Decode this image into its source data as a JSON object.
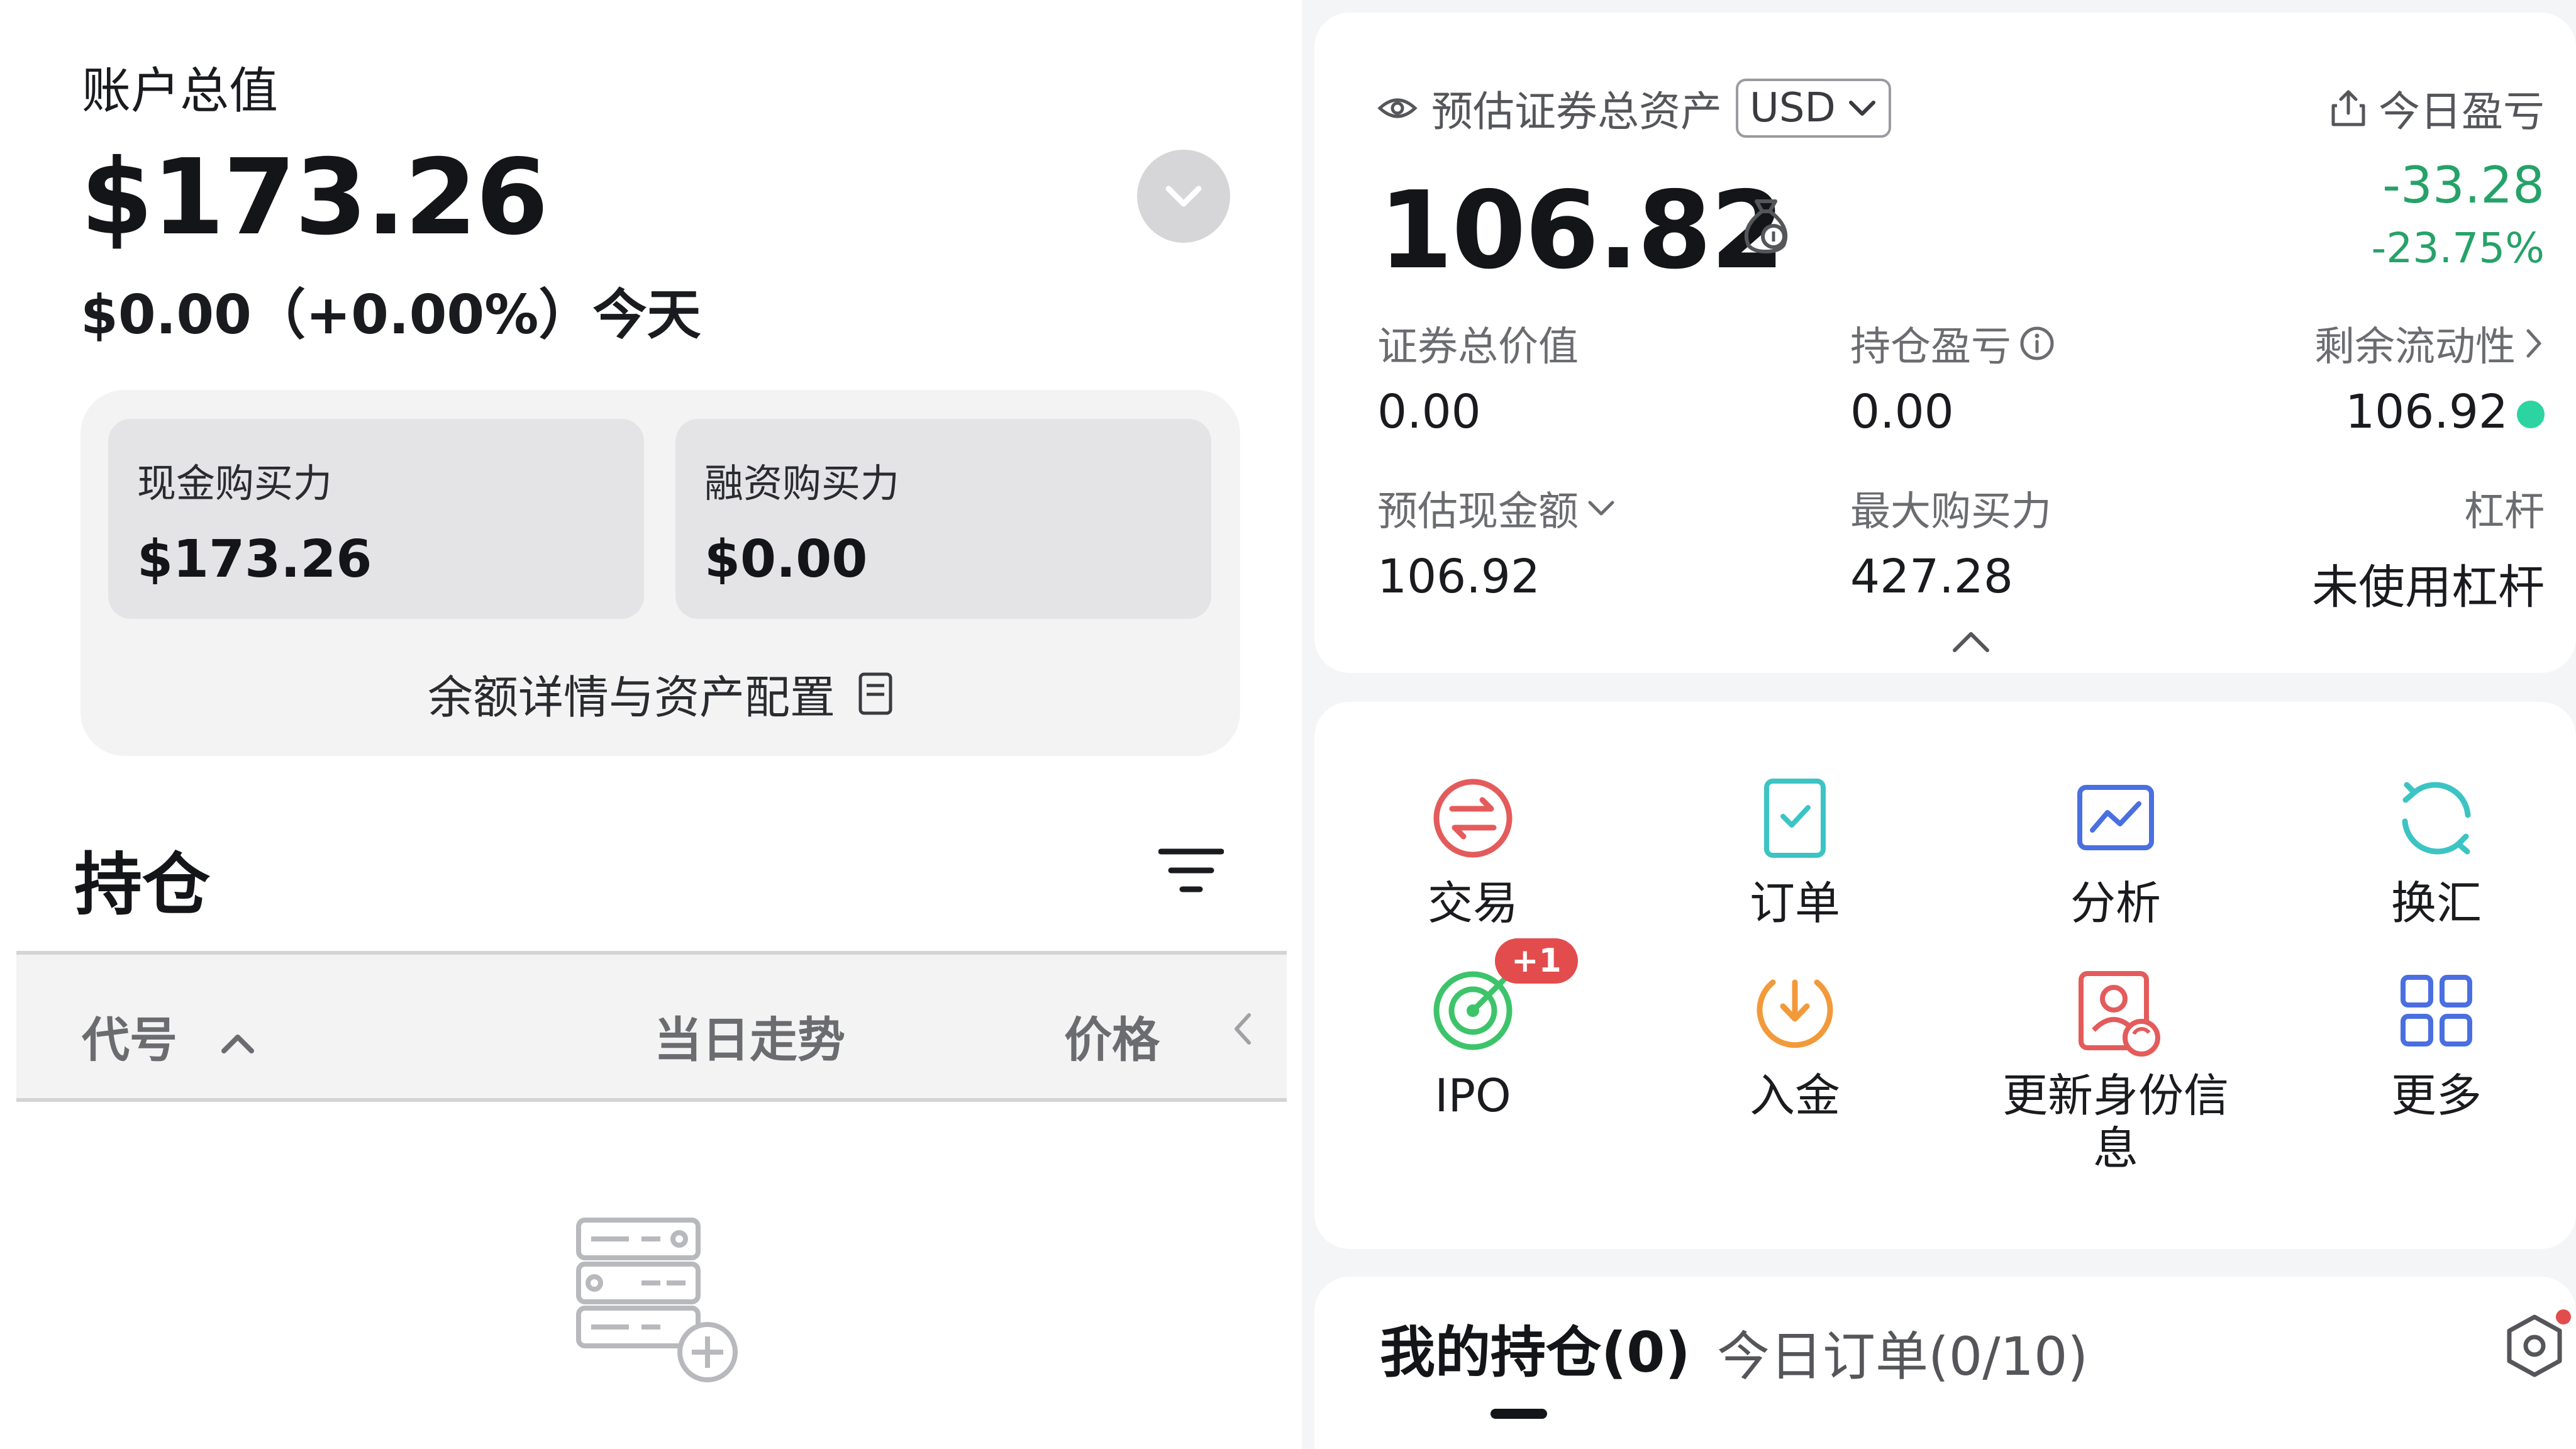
{
  "left": {
    "account_title": "账户总值",
    "account_value": "$173.26",
    "today_change": "$0.00（+0.00%）今天",
    "cash_buying_power": {
      "label": "现金购买力",
      "value": "$173.26"
    },
    "margin_buying_power": {
      "label": "融资购买力",
      "value": "$0.00"
    },
    "balance_link": "余额详情与资产配置",
    "holdings_title": "持仓",
    "table_headers": {
      "symbol": "代号",
      "trend": "当日走势",
      "price": "价格"
    }
  },
  "right": {
    "assets_label": "预估证券总资产",
    "currency": "USD",
    "today_pnl_label": "今日盈亏",
    "total_assets": "106.82",
    "today_pnl": "-33.28",
    "today_pnl_pct": "-23.75%",
    "metrics": [
      {
        "label": "证券总价值",
        "value": "0.00"
      },
      {
        "label": "持仓盈亏",
        "value": "0.00"
      },
      {
        "label": "剩余流动性",
        "value": "106.92"
      },
      {
        "label": "预估现金额",
        "value": "106.92"
      },
      {
        "label": "最大购买力",
        "value": "427.28"
      },
      {
        "label": "杠杆",
        "value": "未使用杠杆"
      }
    ],
    "actions": [
      {
        "label": "交易",
        "icon": "trade-icon"
      },
      {
        "label": "订单",
        "icon": "orders-icon"
      },
      {
        "label": "分析",
        "icon": "analysis-icon"
      },
      {
        "label": "换汇",
        "icon": "exchange-icon"
      },
      {
        "label": "IPO",
        "icon": "ipo-icon",
        "badge": "+1"
      },
      {
        "label": "入金",
        "icon": "deposit-icon"
      },
      {
        "label": "更新身份信息",
        "icon": "identity-icon"
      },
      {
        "label": "更多",
        "icon": "more-grid-icon"
      }
    ],
    "tabs": {
      "positions": "我的持仓(0)",
      "orders": "今日订单(0/10)"
    }
  },
  "colors": {
    "positive_green": "#26a269",
    "badge_red": "#e34c4c",
    "trade_red": "#e45b5b",
    "teal": "#3cc4c4",
    "blue": "#4a6fe0",
    "orange": "#f29a3a",
    "ipo_green": "#3dc46a"
  }
}
